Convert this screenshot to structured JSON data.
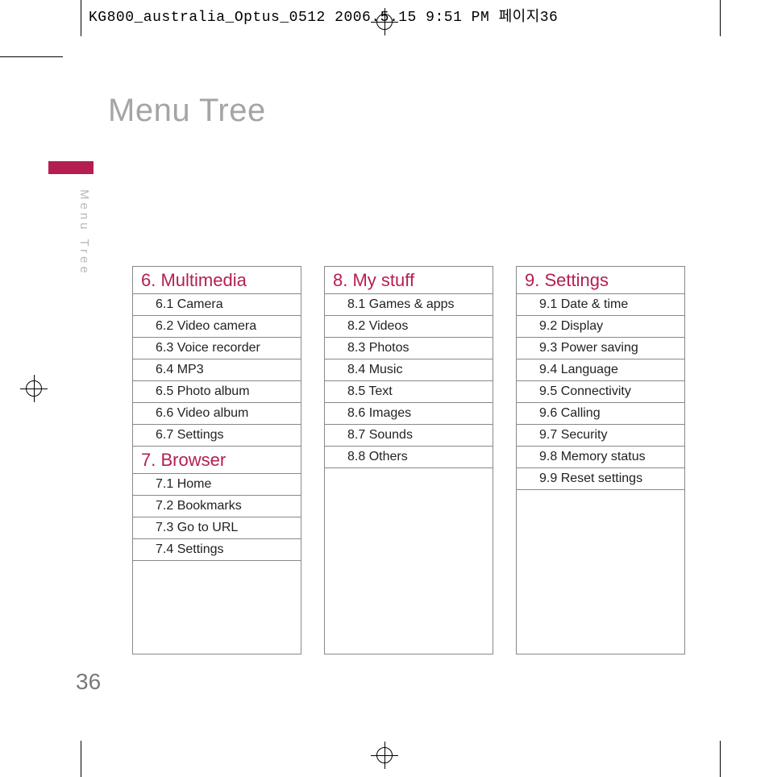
{
  "header_text": "KG800_australia_Optus_0512  2006.5.15 9:51 PM  페이지36",
  "title": "Menu Tree",
  "side_label": "Menu Tree",
  "page_number": "36",
  "columns": [
    {
      "sections": [
        {
          "head": "6. Multimedia",
          "items": [
            "6.1 Camera",
            "6.2 Video camera",
            "6.3 Voice recorder",
            "6.4 MP3",
            "6.5 Photo album",
            "6.6 Video album",
            "6.7 Settings"
          ]
        },
        {
          "head": "7. Browser",
          "items": [
            "7.1 Home",
            "7.2 Bookmarks",
            "7.3 Go to URL",
            "7.4 Settings"
          ]
        }
      ]
    },
    {
      "sections": [
        {
          "head": "8. My stuff",
          "items": [
            "8.1 Games & apps",
            "8.2 Videos",
            "8.3 Photos",
            "8.4 Music",
            "8.5 Text",
            "8.6 Images",
            "8.7 Sounds",
            "8.8 Others"
          ]
        }
      ]
    },
    {
      "sections": [
        {
          "head": "9. Settings",
          "items": [
            "9.1 Date & time",
            "9.2 Display",
            "9.3 Power saving",
            "9.4 Language",
            "9.5 Connectivity",
            "9.6 Calling",
            "9.7 Security",
            "9.8 Memory status",
            "9.9 Reset settings"
          ]
        }
      ]
    }
  ]
}
